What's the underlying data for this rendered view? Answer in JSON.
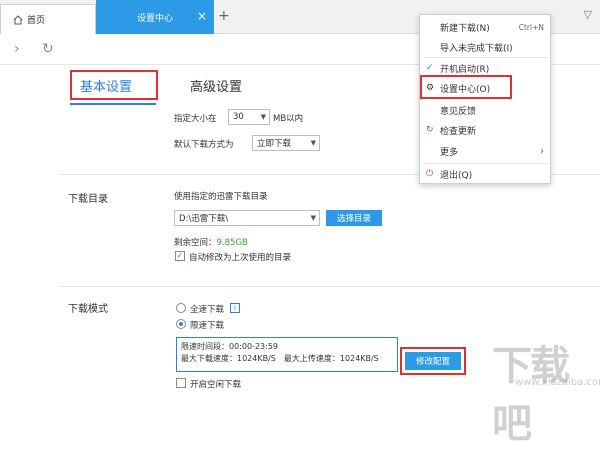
{
  "tabs": {
    "home_label": "首页",
    "active_label": "设置中心",
    "close_glyph": "×",
    "add_glyph": "+"
  },
  "nav": {
    "forward_glyph": "›",
    "refresh_glyph": "↻"
  },
  "settings_tabs": {
    "basic": "基本设置",
    "advanced": "高级设置"
  },
  "download_size": {
    "label": "指定大小在",
    "value": "30",
    "unit": "MB以内",
    "method_label": "默认下载方式为",
    "method_value": "立即下载"
  },
  "download_dir": {
    "section_label": "下载目录",
    "hint": "使用指定的迅雷下载目录",
    "path": "D:\\迅雷下载\\",
    "choose_button": "选择目录",
    "free_space_label": "剩余空间：",
    "free_space_value": "9.85GB",
    "auto_modify_label": "自动修改为上次使用的目录",
    "auto_modify_checked": true
  },
  "download_mode": {
    "section_label": "下载模式",
    "full_speed_label": "全速下载",
    "limit_label": "限速下载",
    "info_glyph": "i",
    "limit_time": "限速时间段：00:00-23:59",
    "limit_speed": "最大下载速度：1024KB/S　最大上传速度：1024KB/S",
    "modify_button": "修改配置",
    "idle_download_label": "开启空闲下载"
  },
  "menu": {
    "items": [
      {
        "icon": "",
        "label": "新建下载(N)",
        "shortcut": "Ctrl+N"
      },
      {
        "icon": "",
        "label": "导入未完成下载(I)",
        "shortcut": ""
      },
      {
        "icon": "✓",
        "label": "开机启动(R)",
        "shortcut": ""
      },
      {
        "icon": "⚙",
        "label": "设置中心(O)",
        "shortcut": ""
      },
      {
        "icon": "",
        "label": "意见反馈",
        "shortcut": ""
      },
      {
        "icon": "↻",
        "label": "检查更新",
        "shortcut": ""
      },
      {
        "icon": "",
        "label": "更多",
        "shortcut": "›"
      },
      {
        "icon": "⏻",
        "label": "退出(Q)",
        "shortcut": ""
      }
    ]
  },
  "watermark": {
    "big": "下载吧",
    "small": "www.xiazaiba.com"
  },
  "colors": {
    "accent": "#2d9ae8",
    "highlight": "#e03030",
    "free_space": "#39a33a"
  }
}
